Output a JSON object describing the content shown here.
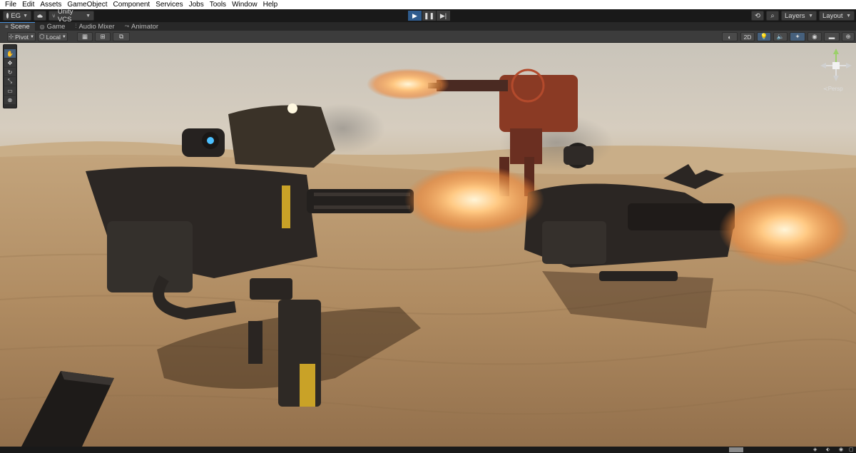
{
  "menubar": {
    "items": [
      "File",
      "Edit",
      "Assets",
      "GameObject",
      "Component",
      "Services",
      "Jobs",
      "Tools",
      "Window",
      "Help"
    ]
  },
  "toolbar": {
    "account_label": "EG",
    "vcs_label": "Unity VCS",
    "layers_label": "Layers",
    "layout_label": "Layout",
    "play_icons": [
      "play-icon",
      "pause-icon",
      "step-icon"
    ]
  },
  "tabs": [
    {
      "label": "Scene",
      "icon": "scene-icon",
      "active": true
    },
    {
      "label": "Game",
      "icon": "game-icon",
      "active": false
    },
    {
      "label": "Audio Mixer",
      "icon": "audio-mixer-icon",
      "active": false
    },
    {
      "label": "Animator",
      "icon": "animator-icon",
      "active": false
    }
  ],
  "scene_toolbar": {
    "pivot_label": "Pivot",
    "space_label": "Local",
    "mode_2d_label": "2D"
  },
  "tools_palette": [
    "hand-tool",
    "move-tool",
    "rotate-tool",
    "scale-tool",
    "rect-tool",
    "transform-tool"
  ],
  "gizmo": {
    "projection_label": "Persp"
  },
  "colors": {
    "accent": "#2f5c8e",
    "sky": "#cfc8bd",
    "sand": "#b7946b",
    "muzzle_flash": "#ffb266"
  }
}
